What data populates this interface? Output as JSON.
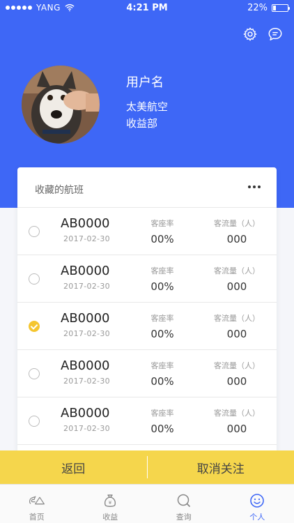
{
  "status_bar": {
    "carrier": "YANG",
    "time": "4:21 PM",
    "battery": "22%"
  },
  "profile": {
    "username": "用户名",
    "company": "太美航空",
    "department": "收益部"
  },
  "favorites": {
    "title": "收藏的航班",
    "flights": [
      {
        "flight_no": "AB0000",
        "date": "2017-02-30",
        "load_factor_label": "客座率",
        "load_factor": "00%",
        "passenger_label": "客流量（人）",
        "passengers": "000",
        "selected": false
      },
      {
        "flight_no": "AB0000",
        "date": "2017-02-30",
        "load_factor_label": "客座率",
        "load_factor": "00%",
        "passenger_label": "客流量（人）",
        "passengers": "000",
        "selected": false
      },
      {
        "flight_no": "AB0000",
        "date": "2017-02-30",
        "load_factor_label": "客座率",
        "load_factor": "00%",
        "passenger_label": "客流量（人）",
        "passengers": "000",
        "selected": true
      },
      {
        "flight_no": "AB0000",
        "date": "2017-02-30",
        "load_factor_label": "客座率",
        "load_factor": "00%",
        "passenger_label": "客流量（人）",
        "passengers": "000",
        "selected": false
      },
      {
        "flight_no": "AB0000",
        "date": "2017-02-30",
        "load_factor_label": "客座率",
        "load_factor": "00%",
        "passenger_label": "客流量（人）",
        "passengers": "000",
        "selected": false
      }
    ]
  },
  "actions": {
    "back": "返回",
    "unfollow": "取消关注"
  },
  "tabs": [
    {
      "label": "首页",
      "icon": "home-logo-icon"
    },
    {
      "label": "收益",
      "icon": "money-bag-icon"
    },
    {
      "label": "查询",
      "icon": "search-icon"
    },
    {
      "label": "个人",
      "icon": "smiley-icon"
    }
  ],
  "colors": {
    "primary": "#3e67f6",
    "accent": "#f5d64c",
    "check": "#f5c62f"
  }
}
